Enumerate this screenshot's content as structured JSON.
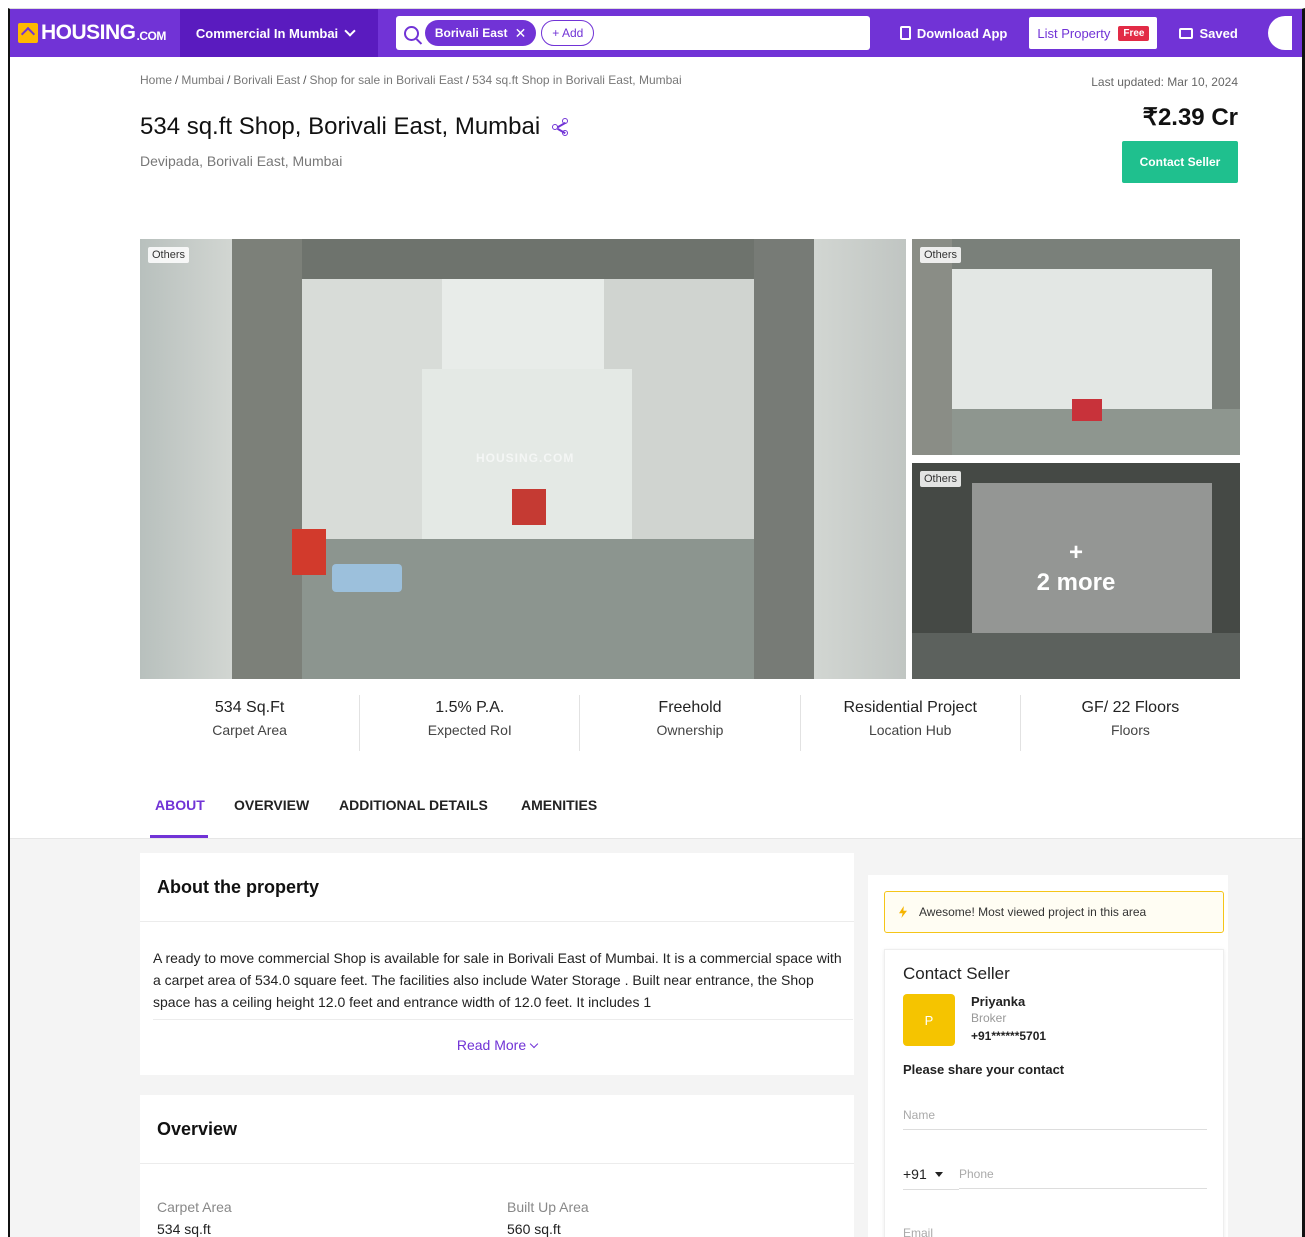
{
  "nav": {
    "logo_text": "HOUSING",
    "logo_suffix": ".COM",
    "city_selector": "Commercial In Mumbai",
    "search_chip": "Borivali East",
    "add_chip": "+ Add",
    "download_app": "Download App",
    "list_property": "List Property",
    "free_badge": "Free",
    "saved": "Saved"
  },
  "breadcrumb": [
    "Home",
    "Mumbai",
    "Borivali East",
    "Shop for sale in Borivali East",
    "534 sq.ft Shop in Borivali East, Mumbai"
  ],
  "header": {
    "last_updated": "Last updated: Mar 10, 2024",
    "title": "534 sq.ft Shop, Borivali East, Mumbai",
    "locality": "Devipada, Borivali East, Mumbai",
    "price": "₹2.39 Cr",
    "contact_button": "Contact Seller"
  },
  "gallery": {
    "main_tag": "Others",
    "side1_tag": "Others",
    "side2_tag": "Others",
    "watermark": "HOUSING.COM",
    "more_plus": "+",
    "more_label": "2 more"
  },
  "stats": [
    {
      "value": "534 Sq.Ft",
      "label": "Carpet Area"
    },
    {
      "value": "1.5% P.A.",
      "label": "Expected RoI"
    },
    {
      "value": "Freehold",
      "label": "Ownership"
    },
    {
      "value": "Residential Project",
      "label": "Location Hub"
    },
    {
      "value": "GF/ 22 Floors",
      "label": "Floors"
    }
  ],
  "tabs": [
    "ABOUT",
    "OVERVIEW",
    "ADDITIONAL DETAILS",
    "AMENITIES"
  ],
  "about": {
    "heading": "About the property",
    "text": "A ready to move commercial Shop is available for sale in Borivali East of Mumbai. It is a commercial space with a carpet area of 534.0 square feet. The facilities also include Water Storage . Built near entrance, the Shop space has a ceiling height 12.0 feet and entrance width of 12.0 feet. It includes 1",
    "read_more": "Read More"
  },
  "overview": {
    "heading": "Overview",
    "items": [
      {
        "label": "Carpet Area",
        "value": "534 sq.ft"
      },
      {
        "label": "Built Up Area",
        "value": "560 sq.ft"
      }
    ]
  },
  "sidebar": {
    "highlight": "Awesome! Most viewed project in this area",
    "contact_heading": "Contact Seller",
    "avatar_initial": "P",
    "seller_name": "Priyanka",
    "seller_role": "Broker",
    "seller_phone": "+91******5701",
    "share_label": "Please share your contact",
    "name_placeholder": "Name",
    "country_code": "+91",
    "phone_placeholder": "Phone",
    "email_placeholder": "Email"
  },
  "colors": {
    "brand_purple": "#7133d6",
    "contact_green": "#1fc08e",
    "free_red": "#e22b46",
    "logo_yellow": "#ffb800"
  }
}
